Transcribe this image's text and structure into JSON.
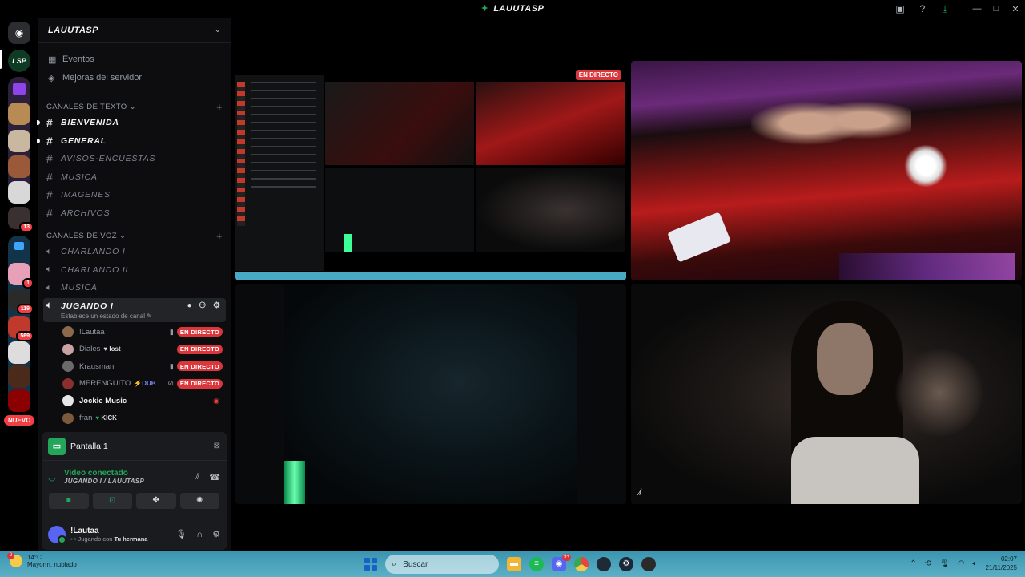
{
  "window": {
    "title": "LAUUTASP",
    "icons": [
      "inbox-icon",
      "help-icon",
      "download-icon"
    ],
    "controls": [
      "minimize",
      "maximize",
      "close"
    ]
  },
  "guilds": {
    "new_label": "NUEVO",
    "badges": [
      "1",
      "119",
      "569",
      "13"
    ]
  },
  "server": {
    "name": "LAUUTASP",
    "menu": [
      {
        "label": "Eventos",
        "icon": "calendar-icon"
      },
      {
        "label": "Mejoras del servidor",
        "icon": "boost-icon"
      }
    ],
    "text_category": "CANALES DE TEXTO",
    "text_channels": [
      {
        "name": "BIENVENIDA",
        "unread": true
      },
      {
        "name": "GENERAL",
        "unread": true
      },
      {
        "name": "AVISOS-ENCUESTAS",
        "unread": false
      },
      {
        "name": "MUSICA",
        "unread": false
      },
      {
        "name": "IMAGENES",
        "unread": false
      },
      {
        "name": "ARCHIVOS",
        "unread": false
      }
    ],
    "voice_category": "CANALES DE VOZ",
    "voice_channels": [
      "CHARLANDO I",
      "CHARLANDO II",
      "MUSICA"
    ],
    "active_channel": {
      "name": "JUGANDO I",
      "status": "Establece un estado de canal"
    },
    "voice_users": [
      {
        "name": "!Lautaa",
        "tag": "",
        "live": "EN DIRECTO",
        "color": "#8a6a4a"
      },
      {
        "name": "Diales",
        "tag": "lost",
        "live": "EN DIRECTO",
        "color": "#c9a3a3"
      },
      {
        "name": "Krausman",
        "tag": "",
        "live": "EN DIRECTO",
        "color": "#6a6a6a"
      },
      {
        "name": "MERENGUITO",
        "tag": "DUB",
        "live": "EN DIRECTO",
        "color": "#8a2f2f"
      },
      {
        "name": "Jockie Music",
        "tag": "",
        "live": "",
        "color": "#e6e6e6"
      },
      {
        "name": "fran",
        "tag": "KICK",
        "live": "",
        "color": "#7a5a3a"
      }
    ]
  },
  "voice_panel": {
    "screen_name": "Pantalla 1",
    "connected": "Video conectado",
    "channel_path": "JUGANDO I / LAUUTASP",
    "actions": [
      "camera-icon",
      "share-screen-icon",
      "activities-icon",
      "soundboard-icon"
    ]
  },
  "user": {
    "name": "!Lautaa",
    "status_prefix": "Jugando con",
    "status_game": "Tu hermana"
  },
  "stage": {
    "live_badge": "EN DIRECTO"
  },
  "taskbar": {
    "temperature": "14°C",
    "weather": "Mayorm. nublado",
    "search_placeholder": "Buscar",
    "apps": [
      {
        "name": "explorer-icon",
        "color": "#f2b632",
        "badge": ""
      },
      {
        "name": "spotify-icon",
        "color": "#1db954",
        "badge": ""
      },
      {
        "name": "discord-icon",
        "color": "#5865f2",
        "badge": "9+"
      },
      {
        "name": "chrome-icon",
        "color": "#e8453c",
        "badge": ""
      },
      {
        "name": "app-dark-icon",
        "color": "#1f2a36",
        "badge": ""
      },
      {
        "name": "steam-icon",
        "color": "#1b2838",
        "badge": ""
      },
      {
        "name": "app-red-icon",
        "color": "#2a2a2a",
        "badge": ""
      }
    ],
    "time": "02:07",
    "date": "21/11/2025"
  }
}
